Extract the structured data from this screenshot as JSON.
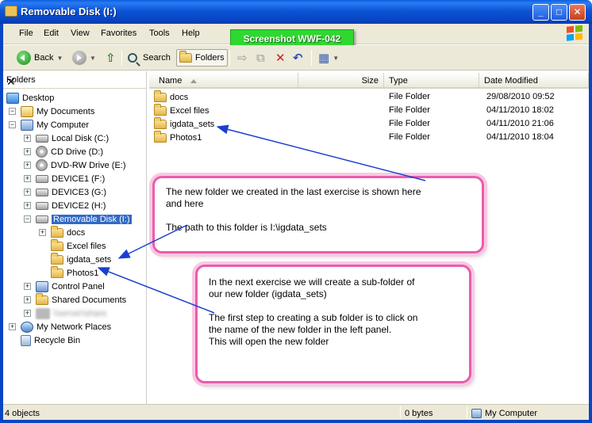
{
  "window": {
    "title": "Removable Disk (I:)",
    "minimize": "_",
    "maximize": "□",
    "close": "✕"
  },
  "menu": [
    "File",
    "Edit",
    "View",
    "Favorites",
    "Tools",
    "Help"
  ],
  "screenshot_label": "Screenshot WWF-042",
  "toolbar": {
    "back": "Back",
    "search": "Search",
    "folders": "Folders"
  },
  "folders_pane": {
    "title": "Folders",
    "close": "✕",
    "items": [
      {
        "label": "Desktop",
        "icon": "desktop-icon"
      },
      {
        "label": "My Documents",
        "icon": "my-documents-icon"
      },
      {
        "label": "My Computer",
        "icon": "my-computer-icon"
      },
      {
        "label": "Local Disk (C:)",
        "icon": "hard-drive-icon"
      },
      {
        "label": "CD Drive (D:)",
        "icon": "cd-drive-icon"
      },
      {
        "label": "DVD-RW Drive (E:)",
        "icon": "dvd-drive-icon"
      },
      {
        "label": "DEVICE1 (F:)",
        "icon": "removable-drive-icon"
      },
      {
        "label": "DEVICE3 (G:)",
        "icon": "removable-drive-icon"
      },
      {
        "label": "DEVICE2 (H:)",
        "icon": "removable-drive-icon"
      },
      {
        "label": "Removable Disk (I:)",
        "icon": "removable-drive-icon"
      },
      {
        "label": "docs",
        "icon": "folder-icon"
      },
      {
        "label": "Excel files",
        "icon": "folder-icon"
      },
      {
        "label": "igdata_sets",
        "icon": "folder-icon"
      },
      {
        "label": "Photos1",
        "icon": "folder-icon"
      },
      {
        "label": "Control Panel",
        "icon": "control-panel-icon"
      },
      {
        "label": "Shared Documents",
        "icon": "folder-icon"
      },
      {
        "label": "\\\\server\\share",
        "icon": "network-drive-icon"
      },
      {
        "label": "My Network Places",
        "icon": "network-places-icon"
      },
      {
        "label": "Recycle Bin",
        "icon": "recycle-bin-icon"
      }
    ]
  },
  "columns": {
    "name": "Name",
    "size": "Size",
    "type": "Type",
    "date": "Date Modified"
  },
  "files": [
    {
      "name": "docs",
      "type": "File Folder",
      "date": "29/08/2010 09:52"
    },
    {
      "name": "Excel files",
      "type": "File Folder",
      "date": "04/11/2010 18:02"
    },
    {
      "name": "igdata_sets",
      "type": "File Folder",
      "date": "04/11/2010 21:06"
    },
    {
      "name": "Photos1",
      "type": "File Folder",
      "date": "04/11/2010 18:04"
    }
  ],
  "callouts": {
    "first": [
      "The new folder we created in the last exercise is shown here",
      "and here",
      "",
      "The path to this folder is I:\\igdata_sets"
    ],
    "second": [
      "In the next exercise we will create a sub-folder of",
      "our new folder (igdata_sets)",
      "",
      "The first step to creating a sub folder is to click on",
      "the name of the new folder in the left panel.",
      "This will open the new folder"
    ]
  },
  "status": {
    "objects": "4 objects",
    "size": "0 bytes",
    "location": "My Computer"
  },
  "colors": {
    "title_bar": "#0846c4",
    "callout_border": "#ea5cad",
    "label_green": "#2fd82f",
    "selection": "#316ac5",
    "arrow": "#1a3fd0"
  }
}
